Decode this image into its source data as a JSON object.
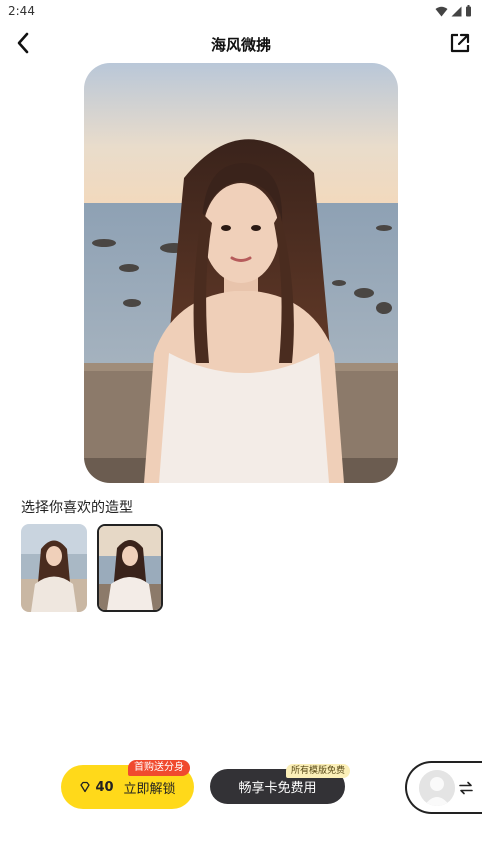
{
  "status_bar": {
    "time": "2:44"
  },
  "header": {
    "title": "海风微拂"
  },
  "style_section": {
    "label": "选择你喜欢的造型",
    "selected_index": 1
  },
  "actions": {
    "unlock": {
      "price": "40",
      "label": "立即解锁",
      "badge": "首购送分身"
    },
    "vip": {
      "label": "畅享卡免费用",
      "badge": "所有模版免费"
    }
  },
  "colors": {
    "accent": "#FFD91A",
    "badge_red": "#F04A2E",
    "dark_button": "#333236"
  },
  "icons": [
    "back-icon",
    "share-icon",
    "wifi-icon",
    "signal-icon",
    "battery-icon",
    "diamond-icon",
    "swap-icon",
    "avatar-placeholder-icon"
  ]
}
